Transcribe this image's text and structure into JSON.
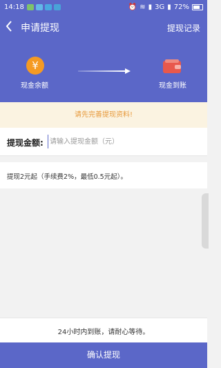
{
  "status_bar": {
    "time": "14:18",
    "network": "3G",
    "battery": "72%",
    "battery_level": 0.72
  },
  "header": {
    "title": "申请提现",
    "right_link": "提现记录"
  },
  "flow": {
    "from_label": "现金余额",
    "to_label": "现金到账",
    "coin_symbol": "¥"
  },
  "notice": "请先完善提现资料!",
  "amount": {
    "label": "提现金额:",
    "placeholder": "请输入提现金额（元）"
  },
  "tip": "提现2元起（手续费2%，最低0.5元起）。",
  "info": "24小时内到账，请耐心等待。",
  "confirm_button": "确认提现",
  "colors": {
    "primary": "#5b67c8",
    "coin": "#f59a23",
    "wallet": "#e8584c",
    "notice_bg": "#fbf3e1",
    "notice_text": "#e79a3c"
  }
}
